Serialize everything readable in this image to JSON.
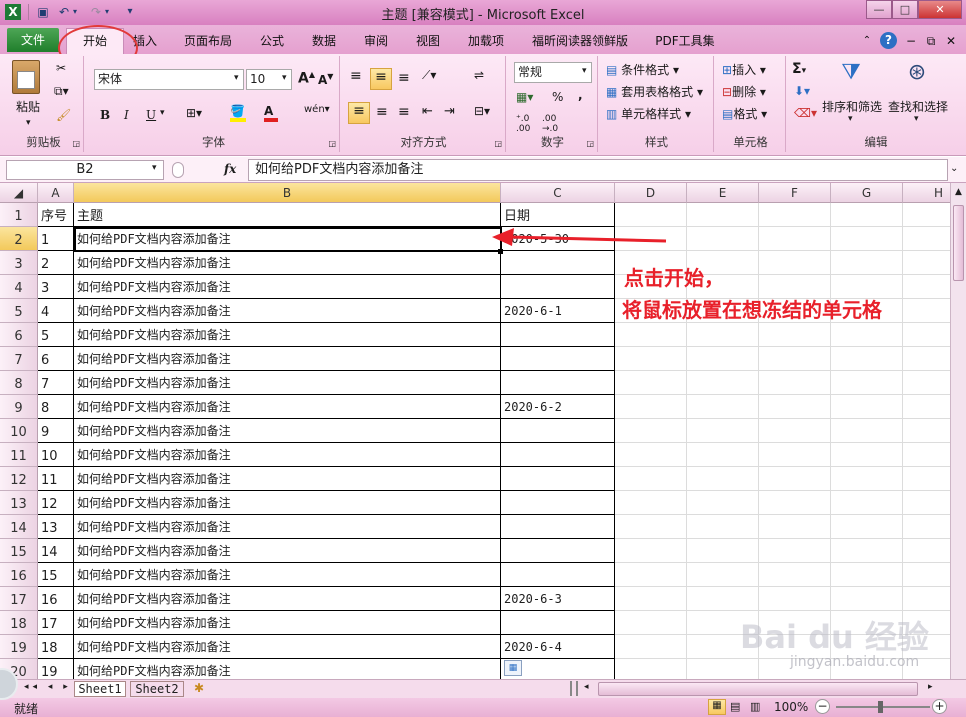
{
  "window": {
    "title": "主题 [兼容模式] - Microsoft Excel",
    "app_icon": "X"
  },
  "tabs": [
    "文件",
    "开始",
    "插入",
    "页面布局",
    "公式",
    "数据",
    "审阅",
    "视图",
    "加载项",
    "福昕阅读器领鲜版",
    "PDF工具集"
  ],
  "ribbon": {
    "clipboard": {
      "paste": "粘贴",
      "label": "剪贴板"
    },
    "font": {
      "name": "宋体",
      "size": "10",
      "label": "字体",
      "bold": "B",
      "italic": "I",
      "underline": "U"
    },
    "alignment": {
      "label": "对齐方式"
    },
    "number": {
      "format": "常规",
      "percent": "%",
      "comma": ",",
      "label": "数字"
    },
    "styles": {
      "conditional": "条件格式",
      "table": "套用表格格式",
      "cell": "单元格样式",
      "label": "样式"
    },
    "cells": {
      "insert": "插入",
      "delete": "删除",
      "format": "格式",
      "label": "单元格"
    },
    "editing": {
      "sigma": "Σ",
      "sort": "排序和筛选",
      "find": "查找和选择",
      "label": "编辑"
    }
  },
  "formula_bar": {
    "namebox": "B2",
    "fx": "fx",
    "content": "如何给PDF文档内容添加备注"
  },
  "columns": [
    "A",
    "B",
    "C",
    "D",
    "E",
    "F",
    "G",
    "H"
  ],
  "rows": [
    {
      "num": "1",
      "a": "序号",
      "b": "主题",
      "c": "日期"
    },
    {
      "num": "2",
      "a": "1",
      "b": "如何给PDF文档内容添加备注",
      "c": "2020-5-30"
    },
    {
      "num": "3",
      "a": "2",
      "b": "如何给PDF文档内容添加备注",
      "c": ""
    },
    {
      "num": "4",
      "a": "3",
      "b": "如何给PDF文档内容添加备注",
      "c": ""
    },
    {
      "num": "5",
      "a": "4",
      "b": "如何给PDF文档内容添加备注",
      "c": "2020-6-1"
    },
    {
      "num": "6",
      "a": "5",
      "b": "如何给PDF文档内容添加备注",
      "c": ""
    },
    {
      "num": "7",
      "a": "6",
      "b": "如何给PDF文档内容添加备注",
      "c": ""
    },
    {
      "num": "8",
      "a": "7",
      "b": "如何给PDF文档内容添加备注",
      "c": ""
    },
    {
      "num": "9",
      "a": "8",
      "b": "如何给PDF文档内容添加备注",
      "c": "2020-6-2"
    },
    {
      "num": "10",
      "a": "9",
      "b": "如何给PDF文档内容添加备注",
      "c": ""
    },
    {
      "num": "11",
      "a": "10",
      "b": "如何给PDF文档内容添加备注",
      "c": ""
    },
    {
      "num": "12",
      "a": "11",
      "b": "如何给PDF文档内容添加备注",
      "c": ""
    },
    {
      "num": "13",
      "a": "12",
      "b": "如何给PDF文档内容添加备注",
      "c": ""
    },
    {
      "num": "14",
      "a": "13",
      "b": "如何给PDF文档内容添加备注",
      "c": ""
    },
    {
      "num": "15",
      "a": "14",
      "b": "如何给PDF文档内容添加备注",
      "c": ""
    },
    {
      "num": "16",
      "a": "15",
      "b": "如何给PDF文档内容添加备注",
      "c": ""
    },
    {
      "num": "17",
      "a": "16",
      "b": "如何给PDF文档内容添加备注",
      "c": "2020-6-3"
    },
    {
      "num": "18",
      "a": "17",
      "b": "如何给PDF文档内容添加备注",
      "c": ""
    },
    {
      "num": "19",
      "a": "18",
      "b": "如何给PDF文档内容添加备注",
      "c": "2020-6-4"
    },
    {
      "num": "20",
      "a": "19",
      "b": "如何给PDF文档内容添加备注",
      "c": ""
    }
  ],
  "annotation": {
    "line1": "点击开始，",
    "line2": "将鼠标放置在想冻结的单元格"
  },
  "sheets": [
    "Sheet1",
    "Sheet2"
  ],
  "status": {
    "mode": "就绪",
    "zoom": "100%"
  },
  "watermark": {
    "brand": "Bai du 经验",
    "url": "jingyan.baidu.com"
  },
  "colors": {
    "accent": "#d880c0",
    "annotation": "#e8202a",
    "file_tab": "#2e8b3a"
  }
}
